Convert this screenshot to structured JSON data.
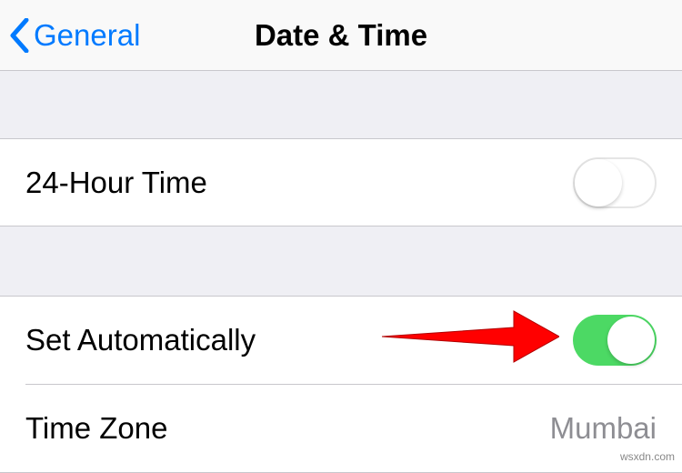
{
  "header": {
    "back_label": "General",
    "title": "Date & Time"
  },
  "rows": {
    "twenty_four_hour": {
      "label": "24-Hour Time",
      "enabled": false
    },
    "set_automatically": {
      "label": "Set Automatically",
      "enabled": true
    },
    "time_zone": {
      "label": "Time Zone",
      "value": "Mumbai"
    }
  },
  "watermark": "wsxdn.com"
}
